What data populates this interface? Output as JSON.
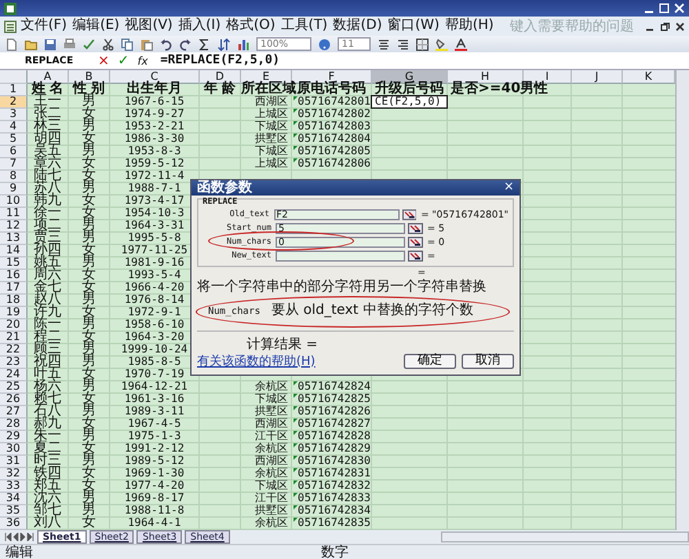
{
  "menu": [
    "文件(F)",
    "编辑(E)",
    "视图(V)",
    "插入(I)",
    "格式(O)",
    "工具(T)",
    "数据(D)",
    "窗口(W)",
    "帮助(H)"
  ],
  "help_box": {
    "placeholder": "键入需要帮助的问题"
  },
  "toolbar": {
    "zoom": "100%",
    "font_size": "11"
  },
  "formula_bar": {
    "name_box": "REPLACE",
    "buttons": [
      "×",
      "✓",
      "fx"
    ],
    "formula": "=REPLACE(F2,5,0)"
  },
  "columns": [
    {
      "letter": "A",
      "selected": false
    },
    {
      "letter": "B",
      "selected": false
    },
    {
      "letter": "C",
      "selected": false
    },
    {
      "letter": "D",
      "selected": false
    },
    {
      "letter": "E",
      "selected": false
    },
    {
      "letter": "F",
      "selected": false
    },
    {
      "letter": "G",
      "selected": true
    },
    {
      "letter": "H",
      "selected": false
    },
    {
      "letter": "I",
      "selected": false
    },
    {
      "letter": "J",
      "selected": false
    },
    {
      "letter": "K",
      "selected": false
    }
  ],
  "header_row": {
    "num": "1",
    "cells": [
      "姓 名",
      "性 别",
      "出生年月",
      "年 龄",
      "所在区域",
      "原电话号码",
      "升级后号码",
      "是否>=40男性"
    ]
  },
  "rows": [
    {
      "num": "2",
      "selected": true,
      "name": "王一",
      "sex": "男",
      "birth": "1967-6-15",
      "region": "西湖区",
      "phone": "05716742801",
      "upgraded": "CE(F2,5,0)"
    },
    {
      "num": "3",
      "selected": false,
      "name": "张二",
      "sex": "女",
      "birth": "1974-9-27",
      "region": "上城区",
      "phone": "05716742802"
    },
    {
      "num": "4",
      "selected": false,
      "name": "林三",
      "sex": "男",
      "birth": "1953-2-21",
      "region": "下城区",
      "phone": "05716742803"
    },
    {
      "num": "5",
      "selected": false,
      "name": "胡四",
      "sex": "女",
      "birth": "1986-3-30",
      "region": "拱墅区",
      "phone": "05716742804"
    },
    {
      "num": "6",
      "selected": false,
      "name": "吴五",
      "sex": "男",
      "birth": "1953-8-3",
      "region": "下城区",
      "phone": "05716742805"
    },
    {
      "num": "7",
      "selected": false,
      "name": "章六",
      "sex": "女",
      "birth": "1959-5-12",
      "region": "上城区",
      "phone": "05716742806"
    },
    {
      "num": "8",
      "selected": false,
      "name": "陆七",
      "sex": "女",
      "birth": "1972-11-4"
    },
    {
      "num": "9",
      "selected": false,
      "name": "苏八",
      "sex": "男",
      "birth": "1988-7-1"
    },
    {
      "num": "10",
      "selected": false,
      "name": "韩九",
      "sex": "女",
      "birth": "1973-4-17"
    },
    {
      "num": "11",
      "selected": false,
      "name": "徐一",
      "sex": "女",
      "birth": "1954-10-3"
    },
    {
      "num": "12",
      "selected": false,
      "name": "项二",
      "sex": "男",
      "birth": "1964-3-31"
    },
    {
      "num": "13",
      "selected": false,
      "name": "贾三",
      "sex": "男",
      "birth": "1995-5-8"
    },
    {
      "num": "14",
      "selected": false,
      "name": "孙四",
      "sex": "女",
      "birth": "1977-11-25"
    },
    {
      "num": "15",
      "selected": false,
      "name": "姚五",
      "sex": "男",
      "birth": "1981-9-16"
    },
    {
      "num": "16",
      "selected": false,
      "name": "周六",
      "sex": "女",
      "birth": "1993-5-4"
    },
    {
      "num": "17",
      "selected": false,
      "name": "金七",
      "sex": "女",
      "birth": "1966-4-20"
    },
    {
      "num": "18",
      "selected": false,
      "name": "赵八",
      "sex": "男",
      "birth": "1976-8-14"
    },
    {
      "num": "19",
      "selected": false,
      "name": "许九",
      "sex": "女",
      "birth": "1972-9-1"
    },
    {
      "num": "20",
      "selected": false,
      "name": "陈一",
      "sex": "男",
      "birth": "1958-6-10"
    },
    {
      "num": "21",
      "selected": false,
      "name": "程二",
      "sex": "女",
      "birth": "1964-3-20"
    },
    {
      "num": "22",
      "selected": false,
      "name": "顾三",
      "sex": "男",
      "birth": "1999-10-24"
    },
    {
      "num": "23",
      "selected": false,
      "name": "祝四",
      "sex": "男",
      "birth": "1985-8-5"
    },
    {
      "num": "24",
      "selected": false,
      "name": "叶五",
      "sex": "女",
      "birth": "1970-7-19"
    },
    {
      "num": "25",
      "selected": false,
      "name": "杨六",
      "sex": "男",
      "birth": "1964-12-21",
      "region": "余杭区",
      "phone": "05716742824"
    },
    {
      "num": "26",
      "selected": false,
      "name": "赖七",
      "sex": "女",
      "birth": "1961-3-16",
      "region": "下城区",
      "phone": "05716742825"
    },
    {
      "num": "27",
      "selected": false,
      "name": "石八",
      "sex": "男",
      "birth": "1989-3-11",
      "region": "拱墅区",
      "phone": "05716742826"
    },
    {
      "num": "28",
      "selected": false,
      "name": "郝九",
      "sex": "女",
      "birth": "1967-4-5",
      "region": "西湖区",
      "phone": "05716742827"
    },
    {
      "num": "29",
      "selected": false,
      "name": "朱一",
      "sex": "男",
      "birth": "1975-1-3",
      "region": "江干区",
      "phone": "05716742828"
    },
    {
      "num": "30",
      "selected": false,
      "name": "夏二",
      "sex": "女",
      "birth": "1991-2-12",
      "region": "余杭区",
      "phone": "05716742829"
    },
    {
      "num": "31",
      "selected": false,
      "name": "时三",
      "sex": "男",
      "birth": "1989-5-12",
      "region": "西湖区",
      "phone": "05716742830"
    },
    {
      "num": "32",
      "selected": false,
      "name": "铁四",
      "sex": "女",
      "birth": "1969-1-30",
      "region": "余杭区",
      "phone": "05716742831"
    },
    {
      "num": "33",
      "selected": false,
      "name": "郑五",
      "sex": "女",
      "birth": "1977-4-20",
      "region": "下城区",
      "phone": "05716742832"
    },
    {
      "num": "34",
      "selected": false,
      "name": "沈六",
      "sex": "男",
      "birth": "1969-8-17",
      "region": "江干区",
      "phone": "05716742833"
    },
    {
      "num": "35",
      "selected": false,
      "name": "邹七",
      "sex": "男",
      "birth": "1988-11-8",
      "region": "拱墅区",
      "phone": "05716742834"
    },
    {
      "num": "36",
      "selected": false,
      "name": "刘八",
      "sex": "女",
      "birth": "1964-4-1",
      "region": "余杭区",
      "phone": "05716742835"
    }
  ],
  "dialog": {
    "title": "函数参数",
    "close": "×",
    "function": "REPLACE",
    "args": [
      {
        "label": "Old_text",
        "value": "F2",
        "result": "= \"05716742801\""
      },
      {
        "label": "Start_num",
        "value": "5",
        "result": "= 5"
      },
      {
        "label": "Num_chars",
        "value": "0",
        "result": "= 0"
      },
      {
        "label": "New_text",
        "result": "="
      }
    ],
    "result": "=",
    "description": "将一个字符串中的部分字符用另一个字符串替换",
    "arg_help": {
      "name": "Num_chars",
      "text": "要从 old_text 中替换的字符个数"
    },
    "calc_result": "计算结果 =",
    "help_link": "有关该函数的帮助(H)",
    "buttons": [
      "确定",
      "取消"
    ]
  },
  "sheet_tabs": [
    {
      "label": "Sheet1",
      "selected": true
    },
    {
      "label": "Sheet2",
      "selected": false
    },
    {
      "label": "Sheet3",
      "selected": false
    },
    {
      "label": "Sheet4",
      "selected": false
    }
  ],
  "status_bar": {
    "mode": "编辑",
    "indicator": "数字"
  }
}
